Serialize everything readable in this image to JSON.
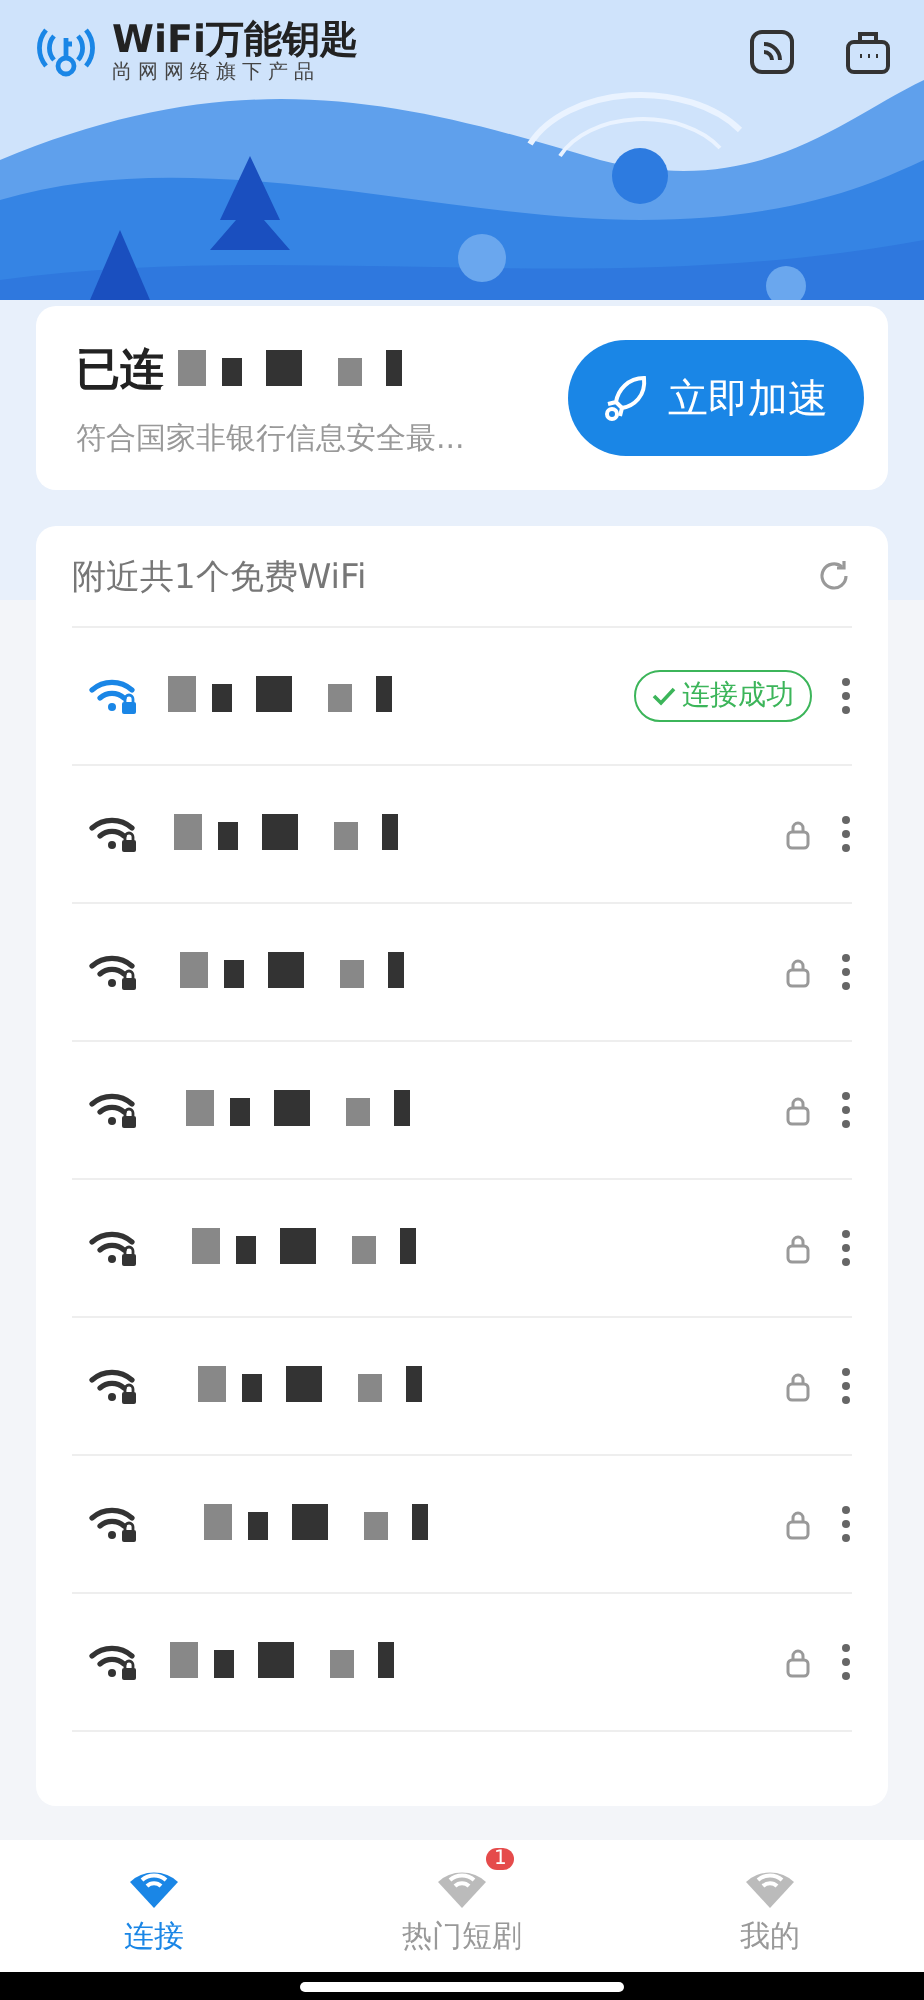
{
  "header": {
    "app_name": "WiFi万能钥匙",
    "tagline": "尚网网络旗下产品"
  },
  "connection": {
    "status": "已连",
    "detail": "符合国家非银行信息安全最...",
    "boost_button": "立即加速"
  },
  "nearby": {
    "title": "附近共1个免费WiFi",
    "networks": [
      {
        "connected": true,
        "locked": true,
        "badge": "连接成功"
      },
      {
        "connected": false,
        "locked": true
      },
      {
        "connected": false,
        "locked": true
      },
      {
        "connected": false,
        "locked": true
      },
      {
        "connected": false,
        "locked": true
      },
      {
        "connected": false,
        "locked": true
      },
      {
        "connected": false,
        "locked": true
      },
      {
        "connected": false,
        "locked": true
      }
    ]
  },
  "tabs": [
    {
      "label": "连接",
      "selected": true
    },
    {
      "label": "热门短剧",
      "selected": false,
      "badge": "1"
    },
    {
      "label": "我的",
      "selected": false
    }
  ]
}
